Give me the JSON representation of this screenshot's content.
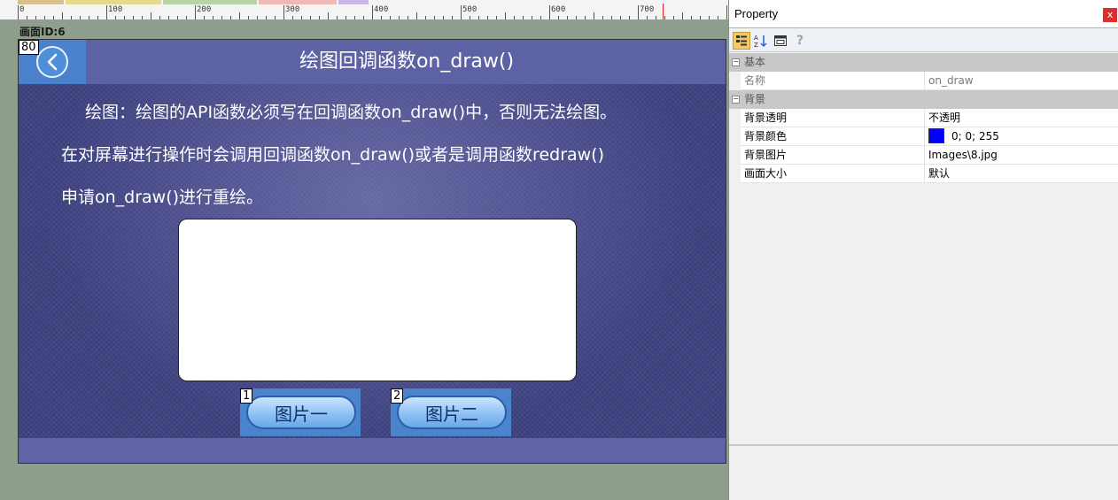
{
  "ruler": {
    "labels": [
      "0",
      "100",
      "200",
      "300",
      "400",
      "500",
      "600",
      "700"
    ]
  },
  "editor": {
    "screen_id_label": "画面ID:6"
  },
  "canvas": {
    "back_button_id": "80",
    "title": "绘图回调函数on_draw()",
    "paragraph_line1": "绘图：绘图的API函数必须写在回调函数on_draw()中，否则无法绘图。",
    "paragraph_line2": "在对屏幕进行操作时会调用回调函数on_draw()或者是调用函数redraw()",
    "paragraph_line3": "申请on_draw()进行重绘。",
    "button1": {
      "id": "1",
      "label": "图片一"
    },
    "button2": {
      "id": "2",
      "label": "图片二"
    }
  },
  "property_panel": {
    "title": "Property",
    "close_label": "x",
    "help_label": "?",
    "categories": [
      {
        "label": "基本",
        "rows": [
          {
            "name": "名称",
            "value": "on_draw"
          }
        ]
      },
      {
        "label": "背景",
        "rows": [
          {
            "name": "背景透明",
            "value": "不透明"
          },
          {
            "name": "背景颜色",
            "value": "0; 0; 255"
          },
          {
            "name": "背景图片",
            "value": "Images\\8.jpg"
          },
          {
            "name": "画面大小",
            "value": "默认"
          }
        ]
      }
    ]
  },
  "colors": {
    "background_color_swatch": "#0000ff",
    "canvas_title_bar": "#5d62a4",
    "button_blue": "#4a84cc"
  }
}
